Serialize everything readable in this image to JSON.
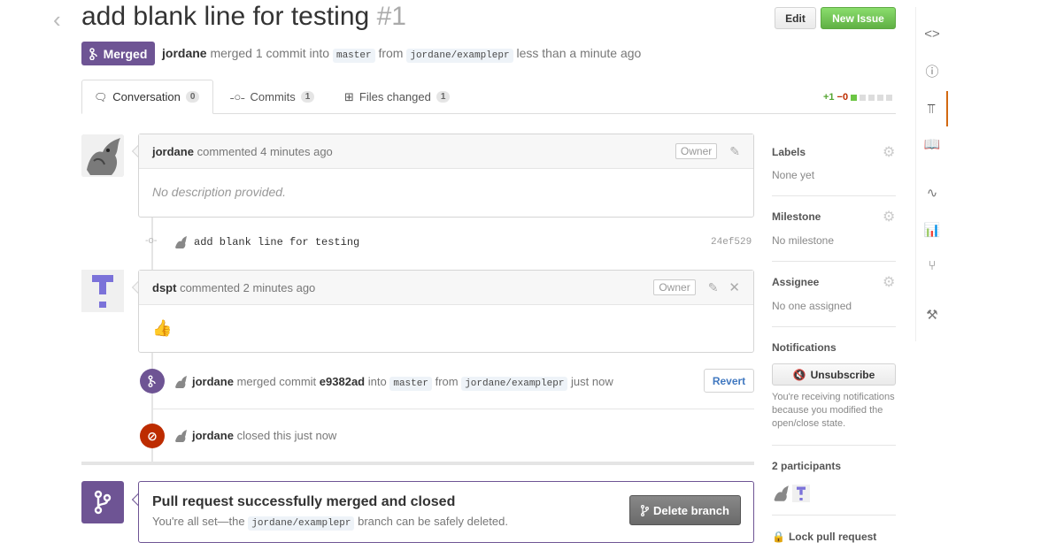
{
  "header": {
    "title": "add blank line for testing",
    "number": "#1",
    "edit_label": "Edit",
    "new_issue_label": "New Issue",
    "state": "Merged",
    "author": "jordane",
    "merge_text": "merged 1 commit into",
    "base_branch": "master",
    "from_text": "from",
    "head_branch": "jordane/examplepr",
    "time_text": "less than a minute ago"
  },
  "tabs": [
    {
      "label": "Conversation",
      "count": "0"
    },
    {
      "label": "Commits",
      "count": "1"
    },
    {
      "label": "Files changed",
      "count": "1"
    }
  ],
  "diffstat": {
    "additions": "+1",
    "deletions": "−0"
  },
  "comment1": {
    "author": "jordane",
    "action": "commented 4 minutes ago",
    "badge": "Owner",
    "body": "No description provided."
  },
  "commit": {
    "message": "add blank line for testing",
    "sha": "24ef529"
  },
  "comment2": {
    "author": "dspt",
    "action": "commented 2 minutes ago",
    "badge": "Owner",
    "body": "👍"
  },
  "merge_event": {
    "author": "jordane",
    "text1": "merged commit",
    "sha": "e9382ad",
    "text2": "into",
    "base": "master",
    "text3": "from",
    "head": "jordane/examplepr",
    "time": "just now",
    "revert_label": "Revert"
  },
  "close_event": {
    "author": "jordane",
    "text": "closed this just now"
  },
  "merged_box": {
    "title": "Pull request successfully merged and closed",
    "text_before": "You're all set—the",
    "branch": "jordane/examplepr",
    "text_after": "branch can be safely deleted.",
    "delete_label": "Delete branch"
  },
  "sidebar": {
    "labels_title": "Labels",
    "labels_value": "None yet",
    "milestone_title": "Milestone",
    "milestone_value": "No milestone",
    "assignee_title": "Assignee",
    "assignee_value": "No one assigned",
    "notifications_title": "Notifications",
    "unsubscribe_label": "Unsubscribe",
    "notifications_note": "You're receiving notifications because you modified the open/close state.",
    "participants_title": "2 participants",
    "lock_label": "Lock pull request"
  },
  "colors": {
    "merged": "#6e5494",
    "closed": "#bd2c00",
    "green": "#60b044",
    "accent": "#d26911"
  }
}
